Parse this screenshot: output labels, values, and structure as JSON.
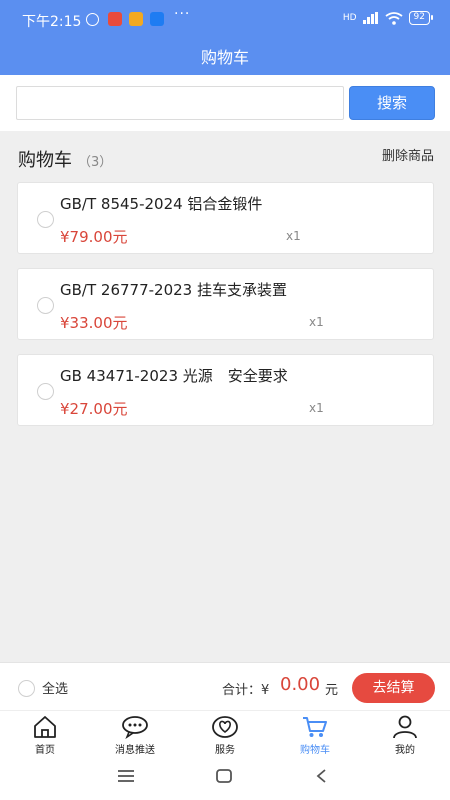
{
  "status_bar": {
    "time": "下午2:15",
    "icons": [
      "alarm-icon",
      "app-icon",
      "app-icon",
      "app-icon"
    ],
    "dots": "···",
    "network": "HD",
    "battery": "92"
  },
  "header": {
    "title": "购物车"
  },
  "search": {
    "placeholder": "",
    "button_label": "搜索"
  },
  "cart": {
    "title": "购物车",
    "count": "（3）",
    "delete_label": "删除商品",
    "items": [
      {
        "name": "GB/T 8545-2024 铝合金锻件",
        "price": "¥79.00元",
        "qty": "x1"
      },
      {
        "name": "GB/T 26777-2023 挂车支承装置",
        "price": "¥33.00元",
        "qty": "x1"
      },
      {
        "name": "GB 43471-2023 光源　安全要求",
        "price": "¥27.00元",
        "qty": "x1"
      }
    ]
  },
  "checkout": {
    "select_all": "全选",
    "total_label": "合计：¥",
    "total_value": "0.00",
    "total_unit": "元",
    "button_label": "去结算"
  },
  "tabbar": {
    "tabs": [
      {
        "label": "首页",
        "icon": "home-icon"
      },
      {
        "label": "消息推送",
        "icon": "message-icon"
      },
      {
        "label": "服务",
        "icon": "heart-icon"
      },
      {
        "label": "购物车",
        "icon": "cart-icon",
        "active": true
      },
      {
        "label": "我的",
        "icon": "user-icon"
      }
    ]
  },
  "colors": {
    "header_bg": "#5b8ff0",
    "accent": "#4a8ef5",
    "price": "#d9463a",
    "checkout_btn": "#e64a40"
  }
}
